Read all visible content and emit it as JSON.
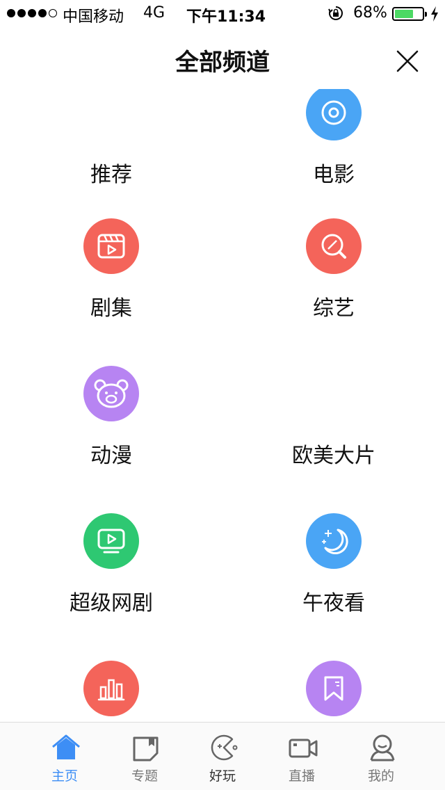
{
  "status_bar": {
    "carrier": "中国移动",
    "network": "4G",
    "time": "下午11:34",
    "battery": "68%",
    "battery_level": 0.68,
    "icons": [
      "signal-dots-icon",
      "orientation-lock-icon",
      "battery-icon",
      "charging-bolt-icon"
    ]
  },
  "nav": {
    "title": "全部频道",
    "close_icon": "close-icon"
  },
  "channels": [
    {
      "label": "推荐",
      "icon": null,
      "color": null
    },
    {
      "label": "电影",
      "icon": "film-icon",
      "color": "#4aa5f5",
      "cut_off_top": true
    },
    {
      "label": "剧集",
      "icon": "clapperboard-play-icon",
      "color": "#f4645a"
    },
    {
      "label": "综艺",
      "icon": "magnifier-mic-icon",
      "color": "#f4645a"
    },
    {
      "label": "动漫",
      "icon": "bear-face-icon",
      "color": "#b784f2"
    },
    {
      "label": "欧美大片",
      "icon": null,
      "color": null
    },
    {
      "label": "超级网剧",
      "icon": "tv-play-icon",
      "color": "#2ec872"
    },
    {
      "label": "午夜看",
      "icon": "moon-stars-icon",
      "color": "#4aa5f5"
    },
    {
      "label": "",
      "icon": "bar-chart-icon",
      "color": "#f4645a"
    },
    {
      "label": "",
      "icon": "bookmark-icon",
      "color": "#b784f2"
    }
  ],
  "tabs": [
    {
      "label": "主页",
      "icon": "home-icon",
      "active": true
    },
    {
      "label": "专题",
      "icon": "topic-icon",
      "active": false
    },
    {
      "label": "好玩",
      "icon": "game-face-icon",
      "active": false
    },
    {
      "label": "直播",
      "icon": "video-camera-icon",
      "active": false
    },
    {
      "label": "我的",
      "icon": "user-icon",
      "active": false
    }
  ],
  "colors": {
    "accent": "#3d8ef5",
    "tab_inactive": "#777777"
  }
}
